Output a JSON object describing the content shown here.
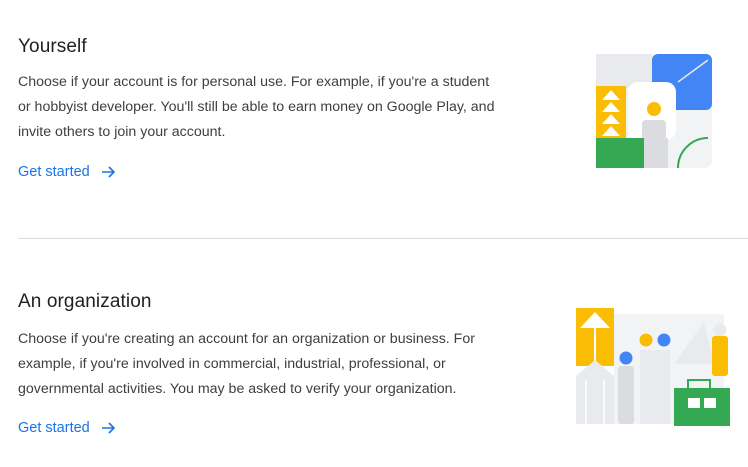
{
  "options": [
    {
      "title": "Yourself",
      "description_lines": [
        "Choose if your account is for personal use. For example, if you're a student",
        "or hobbyist developer. You'll still be able to earn money on Google Play, and",
        "invite others to join your account."
      ],
      "cta_label": "Get started",
      "illustration": "personal-account-illustration"
    },
    {
      "title": "An organization",
      "description_lines": [
        "Choose if you're creating an account for an organization or business. For",
        "example, if you're involved in commercial, industrial, professional, or",
        "governmental activities. You may be asked to verify your organization."
      ],
      "cta_label": "Get started",
      "illustration": "organization-account-illustration"
    }
  ],
  "icons": {
    "cta_arrow": "arrow-right-icon"
  },
  "colors": {
    "link": "#1a73e8",
    "blue": "#4285f4",
    "yellow": "#fbbc04",
    "green": "#34a853",
    "gray": "#dadce0",
    "divider": "#dadce0"
  }
}
